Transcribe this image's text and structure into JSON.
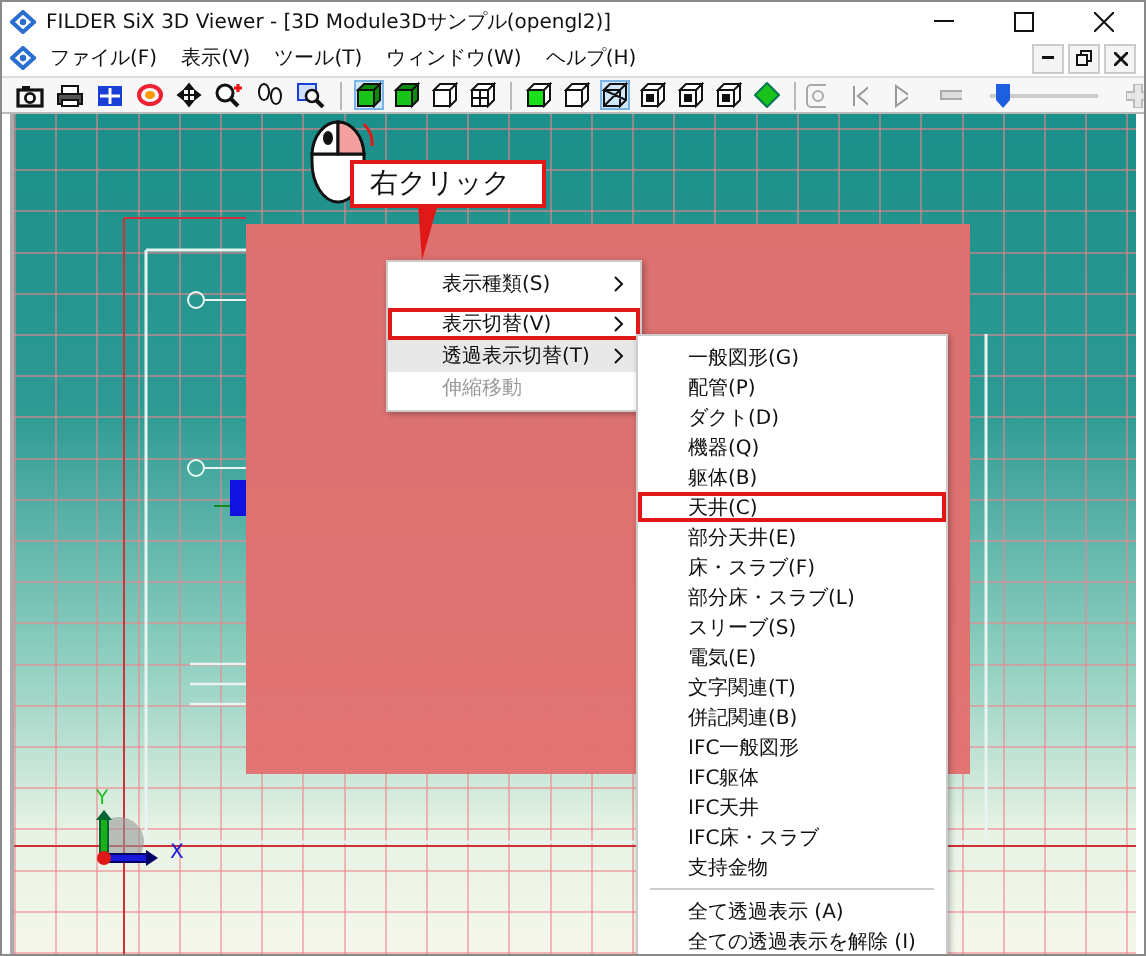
{
  "window": {
    "title": "FILDER SiX 3D Viewer - [3D Module3Dサンプル(opengl2)]"
  },
  "menu_bar": [
    "ファイル(F)",
    "表示(V)",
    "ツール(T)",
    "ウィンドウ(W)",
    "ヘルプ(H)"
  ],
  "toolbar": {
    "buttons": [
      {
        "selected": false
      },
      {
        "selected": false
      },
      {
        "selected": false
      },
      {
        "selected": false
      },
      {
        "selected": false
      },
      {
        "selected": false
      },
      {
        "selected": false
      },
      {
        "selected": false
      },
      {
        "selected": true
      },
      {
        "selected": false
      },
      {
        "selected": false
      },
      {
        "selected": false
      },
      {
        "selected": false
      },
      {
        "selected": false
      },
      {
        "selected": true
      },
      {
        "selected": false
      },
      {
        "selected": false
      },
      {
        "selected": false
      },
      {
        "selected": false
      }
    ],
    "slider": {
      "level": 0.04
    }
  },
  "callout": {
    "text": "右クリック"
  },
  "context_menu": [
    {
      "label": "表示種類(S)",
      "has_submenu": true,
      "disabled": false,
      "hovered": false,
      "highlighted": false
    },
    {
      "label": "表示切替(V)",
      "has_submenu": true,
      "disabled": false,
      "hovered": false,
      "highlighted": true
    },
    {
      "label": "透過表示切替(T)",
      "has_submenu": true,
      "disabled": false,
      "hovered": true,
      "highlighted": false
    },
    {
      "label": "伸縮移動",
      "has_submenu": false,
      "disabled": true,
      "hovered": false,
      "highlighted": false
    }
  ],
  "submenu": [
    {
      "label": "一般図形(G)",
      "highlighted": false
    },
    {
      "label": "配管(P)",
      "highlighted": false
    },
    {
      "label": "ダクト(D)",
      "highlighted": false
    },
    {
      "label": "機器(Q)",
      "highlighted": false
    },
    {
      "label": "躯体(B)",
      "highlighted": false
    },
    {
      "label": "天井(C)",
      "highlighted": true
    },
    {
      "label": "部分天井(E)",
      "highlighted": false
    },
    {
      "label": "床・スラブ(F)",
      "highlighted": false
    },
    {
      "label": "部分床・スラブ(L)",
      "highlighted": false
    },
    {
      "label": "スリーブ(S)",
      "highlighted": false
    },
    {
      "label": "電気(E)",
      "highlighted": false
    },
    {
      "label": "文字関連(T)",
      "highlighted": false
    },
    {
      "label": "併記関連(B)",
      "highlighted": false
    },
    {
      "label": "IFC一般図形",
      "highlighted": false
    },
    {
      "label": "IFC躯体",
      "highlighted": false
    },
    {
      "label": "IFC天井",
      "highlighted": false
    },
    {
      "label": "IFC床・スラブ",
      "highlighted": false
    },
    {
      "label": "支持金物",
      "highlighted": false
    },
    {
      "kind": "separator"
    },
    {
      "label": "全て透過表示 (A)",
      "highlighted": false
    },
    {
      "label": "全ての透過表示を解除 (I)",
      "highlighted": false
    }
  ],
  "axes": {
    "y_label": "Y",
    "x_label": "X"
  }
}
